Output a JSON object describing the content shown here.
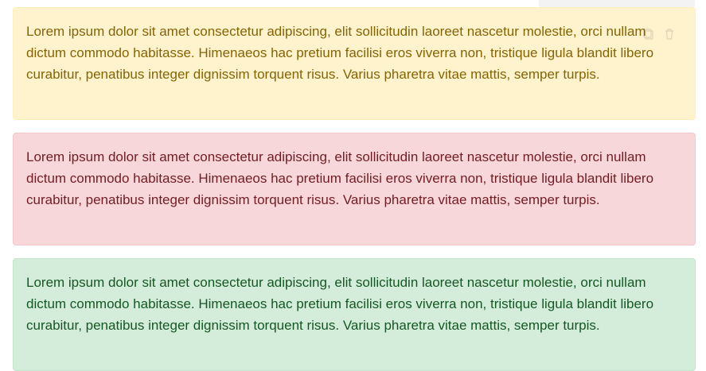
{
  "alerts": [
    {
      "variant": "warning",
      "text": "Lorem ipsum dolor sit amet consectetur adipiscing, elit sollicitudin laoreet nascetur molestie, orci nullam dictum commodo habitasse. Himenaeos hac pretium facilisi eros viverra non, tristique ligula blandit libero curabitur, penatibus integer dignissim torquent risus. Varius pharetra vitae mattis, semper turpis.",
      "background": "#fff3cd",
      "border": "#ffeeba",
      "text_color": "#856404"
    },
    {
      "variant": "danger",
      "text": "Lorem ipsum dolor sit amet consectetur adipiscing, elit sollicitudin laoreet nascetur molestie, orci nullam dictum commodo habitasse. Himenaeos hac pretium facilisi eros viverra non, tristique ligula blandit libero curabitur, penatibus integer dignissim torquent risus. Varius pharetra vitae mattis, semper turpis.",
      "background": "#f8d7da",
      "border": "#f5c6cb",
      "text_color": "#721c24"
    },
    {
      "variant": "success",
      "text": "Lorem ipsum dolor sit amet consectetur adipiscing, elit sollicitudin laoreet nascetur molestie, orci nullam dictum commodo habitasse. Himenaeos hac pretium facilisi eros viverra non, tristique ligula blandit libero curabitur, penatibus integer dignissim torquent risus. Varius pharetra vitae mattis, semper turpis.",
      "background": "#d4edda",
      "border": "#c3e6cb",
      "text_color": "#155724"
    }
  ],
  "icons": {
    "copy": "copy-icon",
    "delete": "trash-icon"
  }
}
